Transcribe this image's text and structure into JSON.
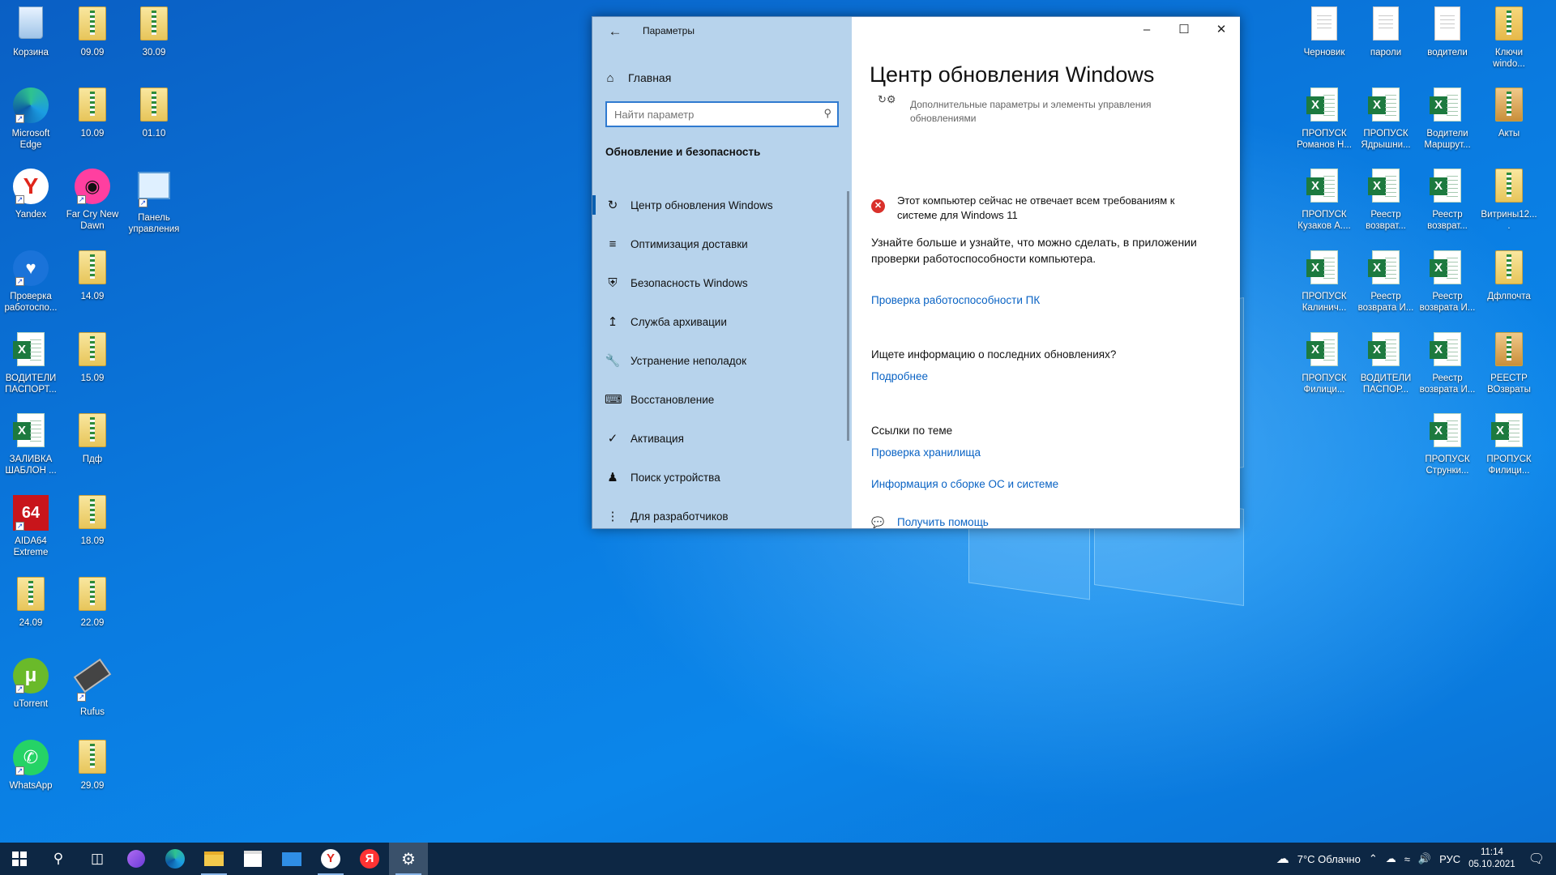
{
  "desktop": {
    "left_icons": [
      {
        "label": "Корзина",
        "icon": "recycle-bin-icon"
      },
      {
        "label": "09.09",
        "icon": "zip-folder-icon"
      },
      {
        "label": "30.09",
        "icon": "zip-folder-icon"
      },
      {
        "label": "Microsoft Edge",
        "icon": "edge-icon"
      },
      {
        "label": "10.09",
        "icon": "zip-folder-icon"
      },
      {
        "label": "01.10",
        "icon": "zip-folder-icon"
      },
      {
        "label": "Yandex",
        "icon": "yandex-icon"
      },
      {
        "label": "Far Cry New Dawn",
        "icon": "far-cry-icon"
      },
      {
        "label": "Панель управления",
        "icon": "control-panel-icon"
      },
      {
        "label": "Проверка работоспо...",
        "icon": "pc-health-icon"
      },
      {
        "label": "14.09",
        "icon": "zip-folder-icon"
      },
      {
        "label": "ВОДИТЕЛИ ПАСПОРТ...",
        "icon": "excel-icon"
      },
      {
        "label": "15.09",
        "icon": "zip-folder-icon"
      },
      {
        "label": "ЗАЛИВКА ШАБЛОН ...",
        "icon": "excel-icon"
      },
      {
        "label": "Пдф",
        "icon": "zip-folder-icon"
      },
      {
        "label": "AIDA64 Extreme",
        "icon": "aida64-icon"
      },
      {
        "label": "18.09",
        "icon": "zip-folder-icon"
      },
      {
        "label": "24.09",
        "icon": "zip-folder-icon"
      },
      {
        "label": "22.09",
        "icon": "zip-folder-icon"
      },
      {
        "label": "uTorrent",
        "icon": "utorrent-icon"
      },
      {
        "label": "Rufus",
        "icon": "rufus-icon"
      },
      {
        "label": "WhatsApp",
        "icon": "whatsapp-icon"
      },
      {
        "label": "29.09",
        "icon": "zip-folder-icon"
      }
    ],
    "right_icons": [
      {
        "label": "Черновик",
        "icon": "document-icon"
      },
      {
        "label": "пароли",
        "icon": "document-icon"
      },
      {
        "label": "водители",
        "icon": "document-icon"
      },
      {
        "label": "Ключи windo...",
        "icon": "folder-icon"
      },
      {
        "label": "ПРОПУСК Романов Н...",
        "icon": "excel-icon"
      },
      {
        "label": "ПРОПУСК Ядрышни...",
        "icon": "excel-icon"
      },
      {
        "label": "Водители Маршрут...",
        "icon": "excel-icon"
      },
      {
        "label": "Акты",
        "icon": "archive-icon"
      },
      {
        "label": "ПРОПУСК Кузаков А....",
        "icon": "excel-icon"
      },
      {
        "label": "Реестр возврат...",
        "icon": "excel-icon"
      },
      {
        "label": "Реестр возврат...",
        "icon": "excel-icon"
      },
      {
        "label": "Витрины12....",
        "icon": "zip-folder-icon"
      },
      {
        "label": "ПРОПУСК Калинич...",
        "icon": "excel-icon"
      },
      {
        "label": "Реестр возврата И...",
        "icon": "excel-icon"
      },
      {
        "label": "Реестр возврата И...",
        "icon": "excel-icon"
      },
      {
        "label": "Дфлпочта",
        "icon": "zip-folder-icon"
      },
      {
        "label": "ПРОПУСК Филици...",
        "icon": "excel-icon"
      },
      {
        "label": "ВОДИТЕЛИ ПАСПОР...",
        "icon": "excel-icon"
      },
      {
        "label": "Реестр возврата И...",
        "icon": "excel-icon"
      },
      {
        "label": "РЕЕСТР ВОзвраты",
        "icon": "archive-icon"
      },
      {
        "label": "ПРОПУСК Струнки...",
        "icon": "excel-icon"
      },
      {
        "label": "ПРОПУСК Филици...",
        "icon": "excel-icon"
      }
    ]
  },
  "settings": {
    "window_title": "Параметры",
    "home_label": "Главная",
    "search_placeholder": "Найти параметр",
    "section_title": "Обновление и безопасность",
    "nav": [
      {
        "label": "Центр обновления Windows",
        "icon": "sync-icon",
        "active": true
      },
      {
        "label": "Оптимизация доставки",
        "icon": "delivery-icon"
      },
      {
        "label": "Безопасность Windows",
        "icon": "shield-icon"
      },
      {
        "label": "Служба архивации",
        "icon": "backup-icon"
      },
      {
        "label": "Устранение неполадок",
        "icon": "wrench-icon"
      },
      {
        "label": "Восстановление",
        "icon": "recovery-icon"
      },
      {
        "label": "Активация",
        "icon": "check-circle-icon"
      },
      {
        "label": "Поиск устройства",
        "icon": "person-pin-icon"
      },
      {
        "label": "Для разработчиков",
        "icon": "developer-icon"
      }
    ],
    "page_title": "Центр обновления Windows",
    "advanced_text": "Дополнительные параметры и элементы управления обновлениями",
    "error_text": "Этот компьютер сейчас не отвечает всем требованиям к системе для Windows 11",
    "info_text": "Узнайте больше и узнайте, что можно сделать, в приложении проверки работоспособности компьютера.",
    "health_check_link": "Проверка работоспособности ПК",
    "recent_updates_label": "Ищете информацию о последних обновлениях?",
    "more_link": "Подробнее",
    "related_label": "Ссылки по теме",
    "storage_link": "Проверка хранилища",
    "os_info_link": "Информация о сборке ОС и системе",
    "help_link": "Получить помощь"
  },
  "taskbar": {
    "weather": "7°C Облачно",
    "language": "РУС",
    "time": "11:14",
    "date": "05.10.2021"
  },
  "colors": {
    "accent": "#0a63c4",
    "sidebar_bg": "#b7d3ec",
    "error": "#d9312b",
    "taskbar_bg": "#0d2744"
  }
}
